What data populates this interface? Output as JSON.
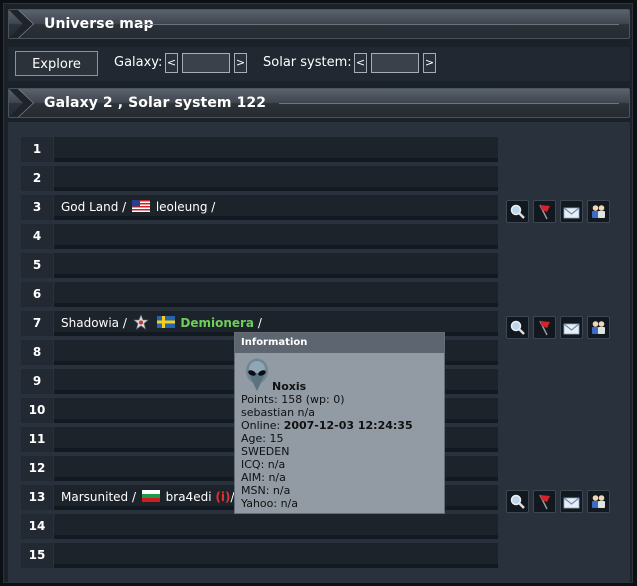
{
  "header": {
    "title": "Universe map"
  },
  "toolbar": {
    "explore_label": "Explore",
    "galaxy_label": "Galaxy:",
    "galaxy_value": "",
    "solar_label": "Solar system:",
    "solar_value": "",
    "prev_symbol": "<",
    "next_symbol": ">"
  },
  "subheader": {
    "title": "Galaxy 2 , Solar system 122"
  },
  "rows": [
    {
      "pos": "1"
    },
    {
      "pos": "2"
    },
    {
      "pos": "3",
      "planet": "God Land",
      "sep1": " / ",
      "player": "leoleung",
      "sep2": " /",
      "flag": "usa-flag"
    },
    {
      "pos": "4"
    },
    {
      "pos": "5"
    },
    {
      "pos": "6"
    },
    {
      "pos": "7",
      "planet": "Shadowia",
      "sep1": " / ",
      "player": "Demionera",
      "sep2": " /",
      "flag": "sweden-flag"
    },
    {
      "pos": "8"
    },
    {
      "pos": "9"
    },
    {
      "pos": "10"
    },
    {
      "pos": "11"
    },
    {
      "pos": "12"
    },
    {
      "pos": "13",
      "planet": "Marsunited",
      "sep1": " / ",
      "player": "bra4edi",
      "tag": "(i)",
      "sep2": "/",
      "flag": "bulgaria-flag"
    },
    {
      "pos": "14"
    },
    {
      "pos": "15"
    }
  ],
  "tooltip": {
    "title": "Information",
    "name": "Noxis",
    "points": "Points: 158 (wp: 0)",
    "realname": "sebastian n/a",
    "online_label": "Online: ",
    "online_value": "2007-12-03 12:24:35",
    "age": "Age: 15",
    "country": "SWEDEN",
    "icq": "ICQ: n/a",
    "aim": "AIM: n/a",
    "msn": "MSN: n/a",
    "yahoo": "Yahoo: n/a"
  },
  "icons": [
    "search-icon",
    "flag-icon",
    "mail-icon",
    "buddy-icon"
  ],
  "colors": {
    "online_player": "#6fce5a",
    "inactive_tag": "#dd3333",
    "background": "#28313c"
  }
}
